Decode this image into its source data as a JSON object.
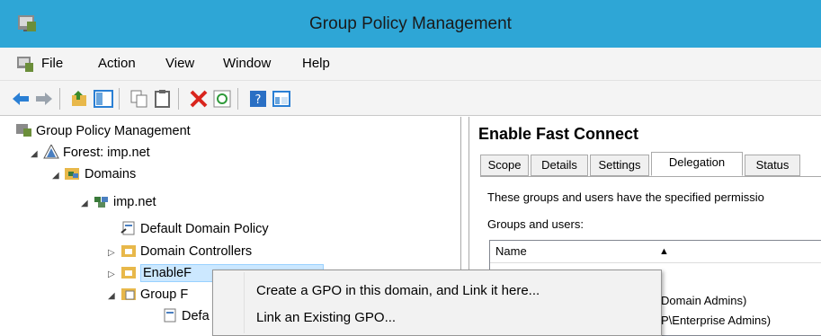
{
  "window": {
    "title": "Group Policy Management"
  },
  "menubar": {
    "items": [
      "File",
      "Action",
      "View",
      "Window",
      "Help"
    ]
  },
  "toolbar": {
    "icons": [
      "back-arrow-icon",
      "forward-arrow-icon",
      "up-folder-icon",
      "show-hide-tree-icon",
      "copy-icon",
      "paste-icon",
      "delete-icon",
      "refresh-icon",
      "help-icon",
      "console-icon"
    ]
  },
  "tree": {
    "items": [
      {
        "label": "Group Policy Management",
        "level": 0
      },
      {
        "label": "Forest: imp.net",
        "level": 1
      },
      {
        "label": "Domains",
        "level": 2
      },
      {
        "label": "imp.net",
        "level": 3
      },
      {
        "label": "Default Domain Policy",
        "level": 4
      },
      {
        "label": "Domain Controllers",
        "level": 4
      },
      {
        "label": "EnableF",
        "level": 4
      },
      {
        "label": "Group F",
        "level": 4
      },
      {
        "label": "Defa",
        "level": 5
      }
    ]
  },
  "details": {
    "title": "Enable Fast Connect",
    "tabs": [
      "Scope",
      "Details",
      "Settings",
      "Delegation",
      "Status"
    ],
    "active_tab": "Delegation",
    "description": "These groups and users have the specified permissio",
    "groups_label": "Groups and users:",
    "column_name": "Name",
    "rows": [
      "Domain Admins)",
      "P\\Enterprise Admins)"
    ]
  },
  "context_menu": {
    "items": [
      "Create a GPO in this domain, and Link it here...",
      "Link an Existing GPO..."
    ]
  }
}
